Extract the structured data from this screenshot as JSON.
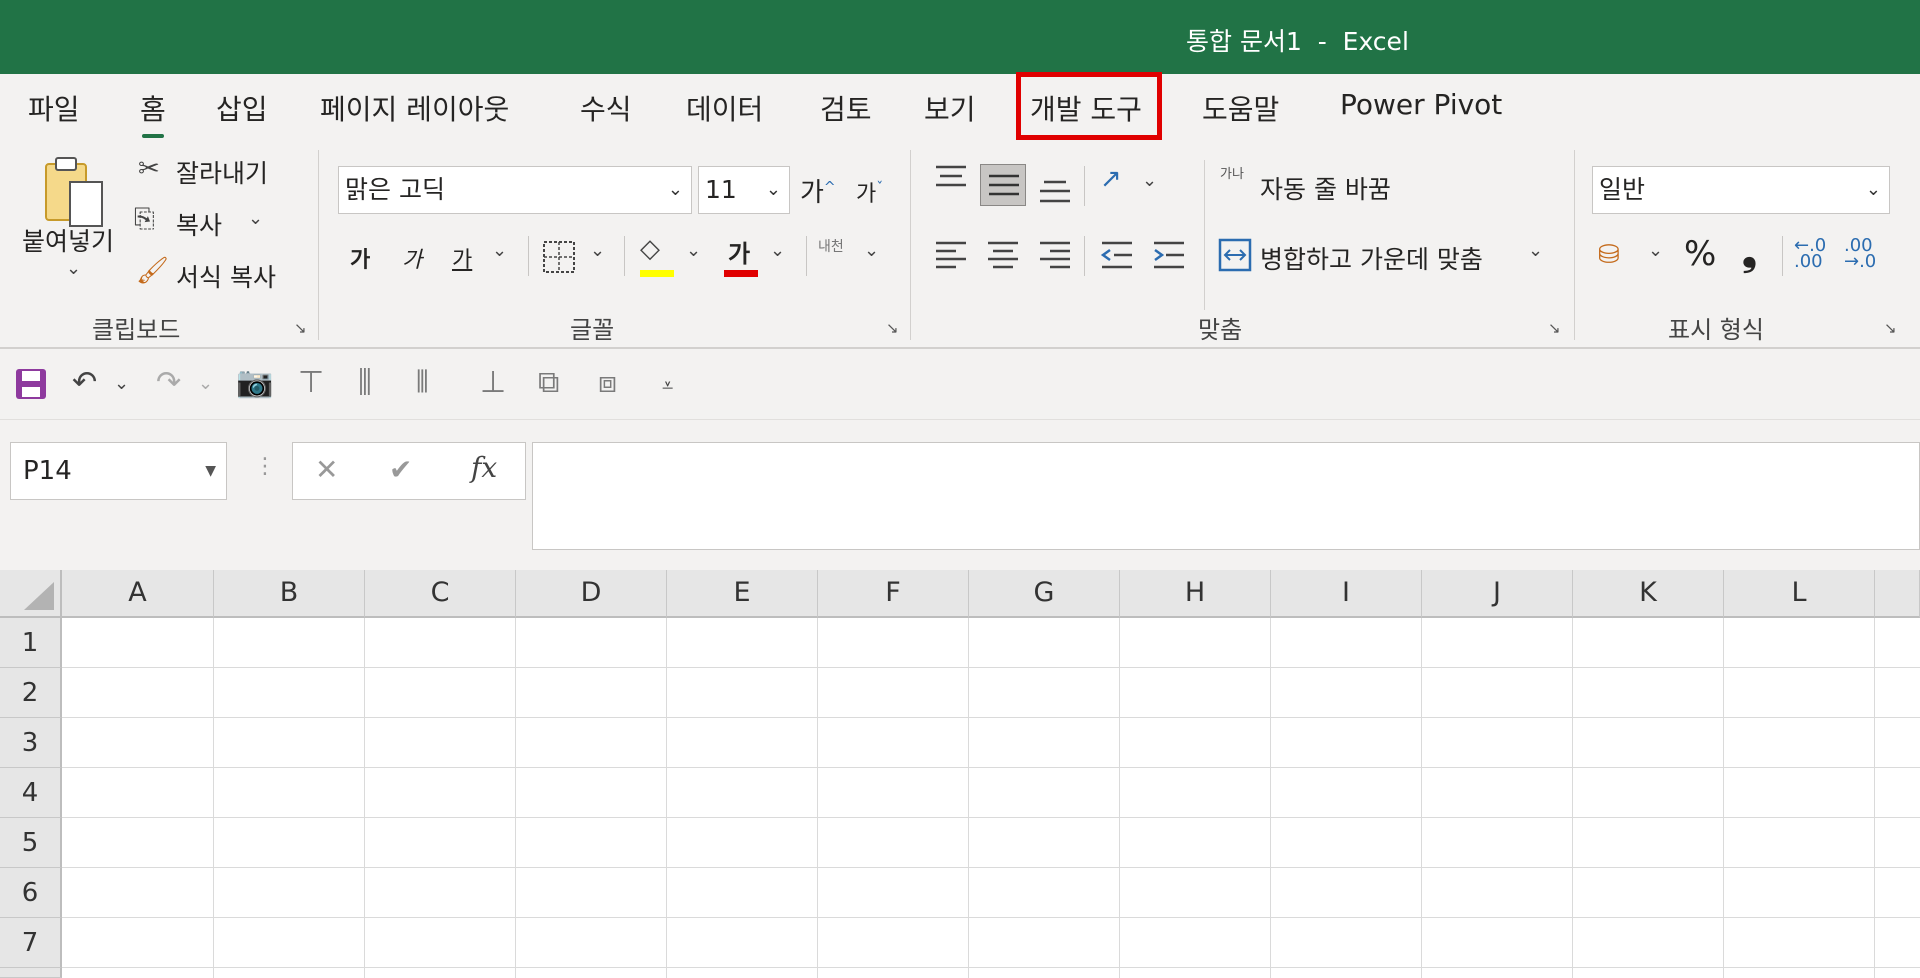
{
  "window": {
    "title": "통합 문서1  -  Excel"
  },
  "tabs": [
    {
      "label": "파일"
    },
    {
      "label": "홈"
    },
    {
      "label": "삽입"
    },
    {
      "label": "페이지 레이아웃"
    },
    {
      "label": "수식"
    },
    {
      "label": "데이터"
    },
    {
      "label": "검토"
    },
    {
      "label": "보기"
    },
    {
      "label": "개발 도구"
    },
    {
      "label": "도움말"
    },
    {
      "label": "Power Pivot"
    }
  ],
  "clipboard": {
    "paste_label": "붙여넣기",
    "cut_label": "잘라내기",
    "copy_label": "복사",
    "format_painter_label": "서식 복사",
    "group_label": "클립보드"
  },
  "font": {
    "font_name": "맑은 고딕",
    "font_size": "11",
    "increase_label": "가",
    "decrease_label": "가",
    "bold_label": "가",
    "italic_label": "가",
    "underline_label": "가",
    "font_color_label": "가",
    "phonetic_label": "내천",
    "group_label": "글꼴",
    "fill_color": "#ffff00",
    "font_color": "#e00000"
  },
  "alignment": {
    "wrap_label": "자동 줄 바꿈",
    "merge_label": "병합하고 가운데 맞춤",
    "wrap_icon_text": "가나",
    "group_label": "맞춤"
  },
  "number": {
    "format": "일반",
    "percent_label": "%",
    "comma_label": "❟",
    "group_label": "표시 형식"
  },
  "qat": {
    "icons": [
      "save-icon",
      "undo-icon",
      "redo-icon",
      "camera-icon",
      "align-top-icon",
      "align-middle-icon",
      "distribute-icon",
      "align-bottom-icon",
      "bring-forward-icon",
      "send-backward-icon",
      "customize-qat-icon"
    ]
  },
  "formula_bar": {
    "name_box": "P14",
    "fx_label": "fx",
    "cancel_label": "✕",
    "enter_label": "✔",
    "formula": ""
  },
  "grid": {
    "columns": [
      "A",
      "B",
      "C",
      "D",
      "E",
      "F",
      "G",
      "H",
      "I",
      "J",
      "K",
      "L"
    ],
    "rows": [
      "1",
      "2",
      "3",
      "4",
      "5",
      "6",
      "7"
    ]
  },
  "colors": {
    "title_bar": "#217346",
    "accent": "#217346",
    "highlight": "#e00000"
  }
}
